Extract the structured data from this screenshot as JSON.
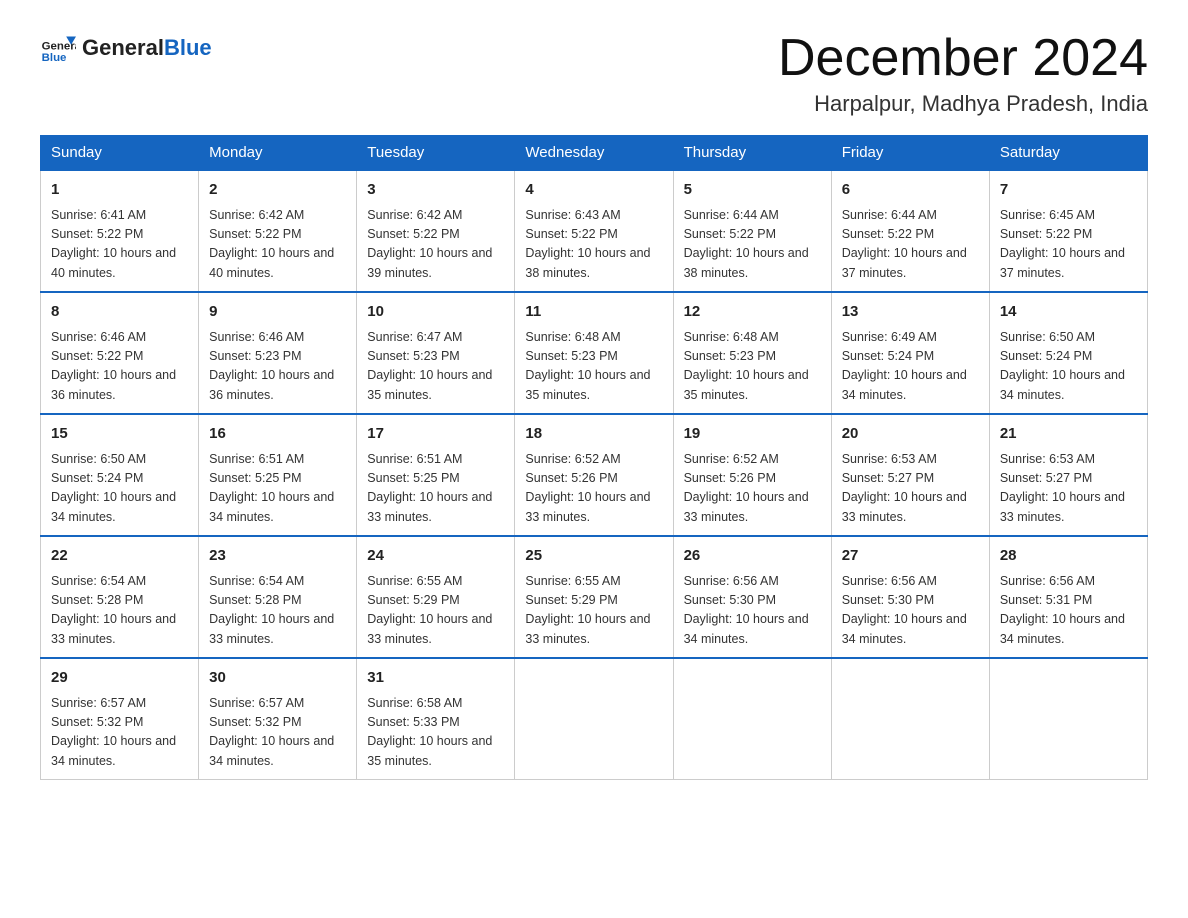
{
  "header": {
    "logo_general": "General",
    "logo_blue": "Blue",
    "month_title": "December 2024",
    "location": "Harpalpur, Madhya Pradesh, India"
  },
  "days_of_week": [
    "Sunday",
    "Monday",
    "Tuesday",
    "Wednesday",
    "Thursday",
    "Friday",
    "Saturday"
  ],
  "weeks": [
    [
      {
        "day": "1",
        "sunrise": "6:41 AM",
        "sunset": "5:22 PM",
        "daylight": "10 hours and 40 minutes."
      },
      {
        "day": "2",
        "sunrise": "6:42 AM",
        "sunset": "5:22 PM",
        "daylight": "10 hours and 40 minutes."
      },
      {
        "day": "3",
        "sunrise": "6:42 AM",
        "sunset": "5:22 PM",
        "daylight": "10 hours and 39 minutes."
      },
      {
        "day": "4",
        "sunrise": "6:43 AM",
        "sunset": "5:22 PM",
        "daylight": "10 hours and 38 minutes."
      },
      {
        "day": "5",
        "sunrise": "6:44 AM",
        "sunset": "5:22 PM",
        "daylight": "10 hours and 38 minutes."
      },
      {
        "day": "6",
        "sunrise": "6:44 AM",
        "sunset": "5:22 PM",
        "daylight": "10 hours and 37 minutes."
      },
      {
        "day": "7",
        "sunrise": "6:45 AM",
        "sunset": "5:22 PM",
        "daylight": "10 hours and 37 minutes."
      }
    ],
    [
      {
        "day": "8",
        "sunrise": "6:46 AM",
        "sunset": "5:22 PM",
        "daylight": "10 hours and 36 minutes."
      },
      {
        "day": "9",
        "sunrise": "6:46 AM",
        "sunset": "5:23 PM",
        "daylight": "10 hours and 36 minutes."
      },
      {
        "day": "10",
        "sunrise": "6:47 AM",
        "sunset": "5:23 PM",
        "daylight": "10 hours and 35 minutes."
      },
      {
        "day": "11",
        "sunrise": "6:48 AM",
        "sunset": "5:23 PM",
        "daylight": "10 hours and 35 minutes."
      },
      {
        "day": "12",
        "sunrise": "6:48 AM",
        "sunset": "5:23 PM",
        "daylight": "10 hours and 35 minutes."
      },
      {
        "day": "13",
        "sunrise": "6:49 AM",
        "sunset": "5:24 PM",
        "daylight": "10 hours and 34 minutes."
      },
      {
        "day": "14",
        "sunrise": "6:50 AM",
        "sunset": "5:24 PM",
        "daylight": "10 hours and 34 minutes."
      }
    ],
    [
      {
        "day": "15",
        "sunrise": "6:50 AM",
        "sunset": "5:24 PM",
        "daylight": "10 hours and 34 minutes."
      },
      {
        "day": "16",
        "sunrise": "6:51 AM",
        "sunset": "5:25 PM",
        "daylight": "10 hours and 34 minutes."
      },
      {
        "day": "17",
        "sunrise": "6:51 AM",
        "sunset": "5:25 PM",
        "daylight": "10 hours and 33 minutes."
      },
      {
        "day": "18",
        "sunrise": "6:52 AM",
        "sunset": "5:26 PM",
        "daylight": "10 hours and 33 minutes."
      },
      {
        "day": "19",
        "sunrise": "6:52 AM",
        "sunset": "5:26 PM",
        "daylight": "10 hours and 33 minutes."
      },
      {
        "day": "20",
        "sunrise": "6:53 AM",
        "sunset": "5:27 PM",
        "daylight": "10 hours and 33 minutes."
      },
      {
        "day": "21",
        "sunrise": "6:53 AM",
        "sunset": "5:27 PM",
        "daylight": "10 hours and 33 minutes."
      }
    ],
    [
      {
        "day": "22",
        "sunrise": "6:54 AM",
        "sunset": "5:28 PM",
        "daylight": "10 hours and 33 minutes."
      },
      {
        "day": "23",
        "sunrise": "6:54 AM",
        "sunset": "5:28 PM",
        "daylight": "10 hours and 33 minutes."
      },
      {
        "day": "24",
        "sunrise": "6:55 AM",
        "sunset": "5:29 PM",
        "daylight": "10 hours and 33 minutes."
      },
      {
        "day": "25",
        "sunrise": "6:55 AM",
        "sunset": "5:29 PM",
        "daylight": "10 hours and 33 minutes."
      },
      {
        "day": "26",
        "sunrise": "6:56 AM",
        "sunset": "5:30 PM",
        "daylight": "10 hours and 34 minutes."
      },
      {
        "day": "27",
        "sunrise": "6:56 AM",
        "sunset": "5:30 PM",
        "daylight": "10 hours and 34 minutes."
      },
      {
        "day": "28",
        "sunrise": "6:56 AM",
        "sunset": "5:31 PM",
        "daylight": "10 hours and 34 minutes."
      }
    ],
    [
      {
        "day": "29",
        "sunrise": "6:57 AM",
        "sunset": "5:32 PM",
        "daylight": "10 hours and 34 minutes."
      },
      {
        "day": "30",
        "sunrise": "6:57 AM",
        "sunset": "5:32 PM",
        "daylight": "10 hours and 34 minutes."
      },
      {
        "day": "31",
        "sunrise": "6:58 AM",
        "sunset": "5:33 PM",
        "daylight": "10 hours and 35 minutes."
      },
      null,
      null,
      null,
      null
    ]
  ]
}
